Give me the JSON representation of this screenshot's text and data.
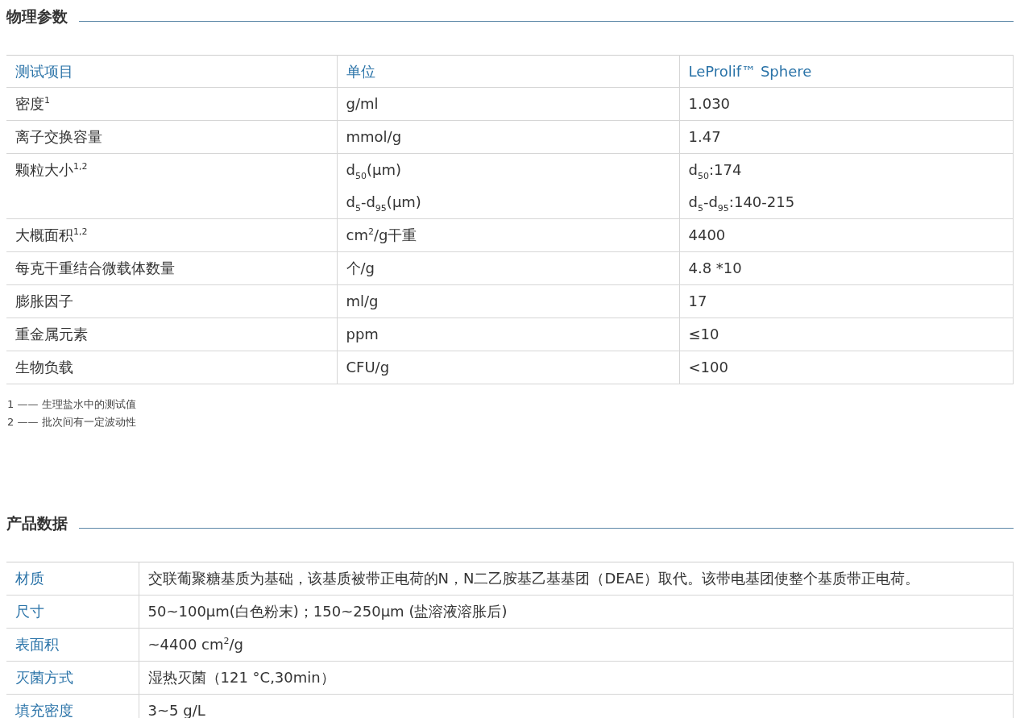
{
  "sections": [
    {
      "kind": "grid",
      "title": "物理参数",
      "columns": [
        "测试项目",
        "单位",
        "LeProlif™ Sphere"
      ],
      "rows": [
        {
          "cells": [
            [
              "密度$^{1}$"
            ],
            [
              "g/ml"
            ],
            [
              "1.030"
            ]
          ]
        },
        {
          "cells": [
            [
              "离子交换容量"
            ],
            [
              "mmol/g"
            ],
            [
              "1.47"
            ]
          ]
        },
        {
          "cells": [
            [
              "颗粒大小$^{1,2}$"
            ],
            [
              "d$_{50}$(μm)",
              "d$_{5}$-d$_{95}$(μm)"
            ],
            [
              "d$_{50}$:174",
              "d$_{5}$-d$_{95}$:140-215"
            ]
          ]
        },
        {
          "cells": [
            [
              "大概面积$^{1,2}$"
            ],
            [
              "cm$^{2}$/g干重"
            ],
            [
              "4400"
            ]
          ]
        },
        {
          "cells": [
            [
              "每克干重结合微载体数量"
            ],
            [
              "个/g"
            ],
            [
              "4.8 *10"
            ]
          ]
        },
        {
          "cells": [
            [
              "膨胀因子"
            ],
            [
              "ml/g"
            ],
            [
              "17"
            ]
          ]
        },
        {
          "cells": [
            [
              "重金属元素"
            ],
            [
              "ppm"
            ],
            [
              "≤10"
            ]
          ]
        },
        {
          "cells": [
            [
              "生物负载"
            ],
            [
              "CFU/g"
            ],
            [
              "<100"
            ]
          ]
        }
      ],
      "notes": [
        "1 —— 生理盐水中的测试值",
        "2 —— 批次间有一定波动性"
      ]
    },
    {
      "kind": "props",
      "title": "产品数据",
      "rows": [
        {
          "cells": [
            [
              "材质"
            ],
            [
              "交联葡聚糖基质为基础，该基质被带正电荷的N，N二乙胺基乙基基团（DEAE）取代。该带电基团使整个基质带正电荷。"
            ]
          ]
        },
        {
          "cells": [
            [
              "尺寸"
            ],
            [
              "50~100μm(白色粉末)；150~250μm (盐溶液溶胀后)"
            ]
          ]
        },
        {
          "cells": [
            [
              "表面积"
            ],
            [
              "~4400 cm$^{2}$/g"
            ]
          ]
        },
        {
          "cells": [
            [
              "灭菌方式"
            ],
            [
              "湿热灭菌（121 °C,30min）"
            ]
          ]
        },
        {
          "cells": [
            [
              "填充密度"
            ],
            [
              "3~5 g/L"
            ]
          ]
        }
      ]
    }
  ]
}
